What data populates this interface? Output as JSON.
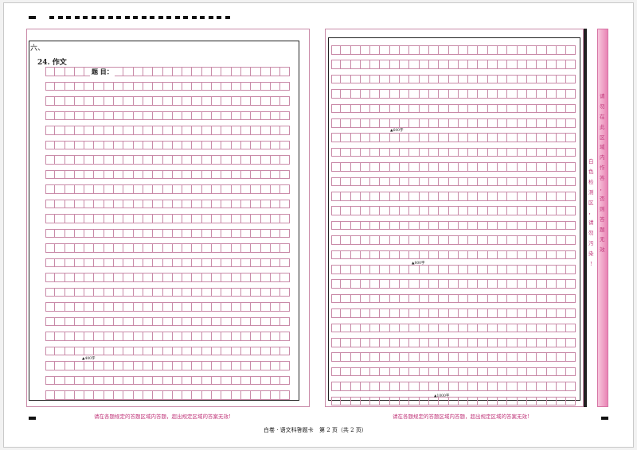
{
  "left_section": {
    "section_label": "六、",
    "question_title": "24. 作文",
    "topic_label": "题 目："
  },
  "markers": {
    "left_400": "▲400字",
    "right_600": "▲600字",
    "right_800": "▲800字",
    "right_1000": "▲1000字"
  },
  "warnings": {
    "left": "请在各题规定的答题区域内答题，超出规定区域的答案无效!",
    "right": "请在各题规定的答题区域内答题，超出规定区域的答案无效!"
  },
  "side_notice": {
    "col1": [
      "白",
      "色",
      "检",
      "测",
      "区",
      "，",
      "请",
      "勿",
      "污",
      "染",
      "!"
    ],
    "col2": [
      "请",
      "勿",
      "在",
      "此",
      "区",
      "域",
      "内",
      "作",
      "答",
      "，",
      "否",
      "则",
      "答",
      "题",
      "无",
      "效"
    ]
  },
  "footer": {
    "title": "白卷 · 语文科答题卡",
    "page": "第 2 页（共 2 页）"
  },
  "colors": {
    "grid_pink": "#c98aa8",
    "warning_magenta": "#c0367a",
    "strip_pink": "#e884b4"
  }
}
